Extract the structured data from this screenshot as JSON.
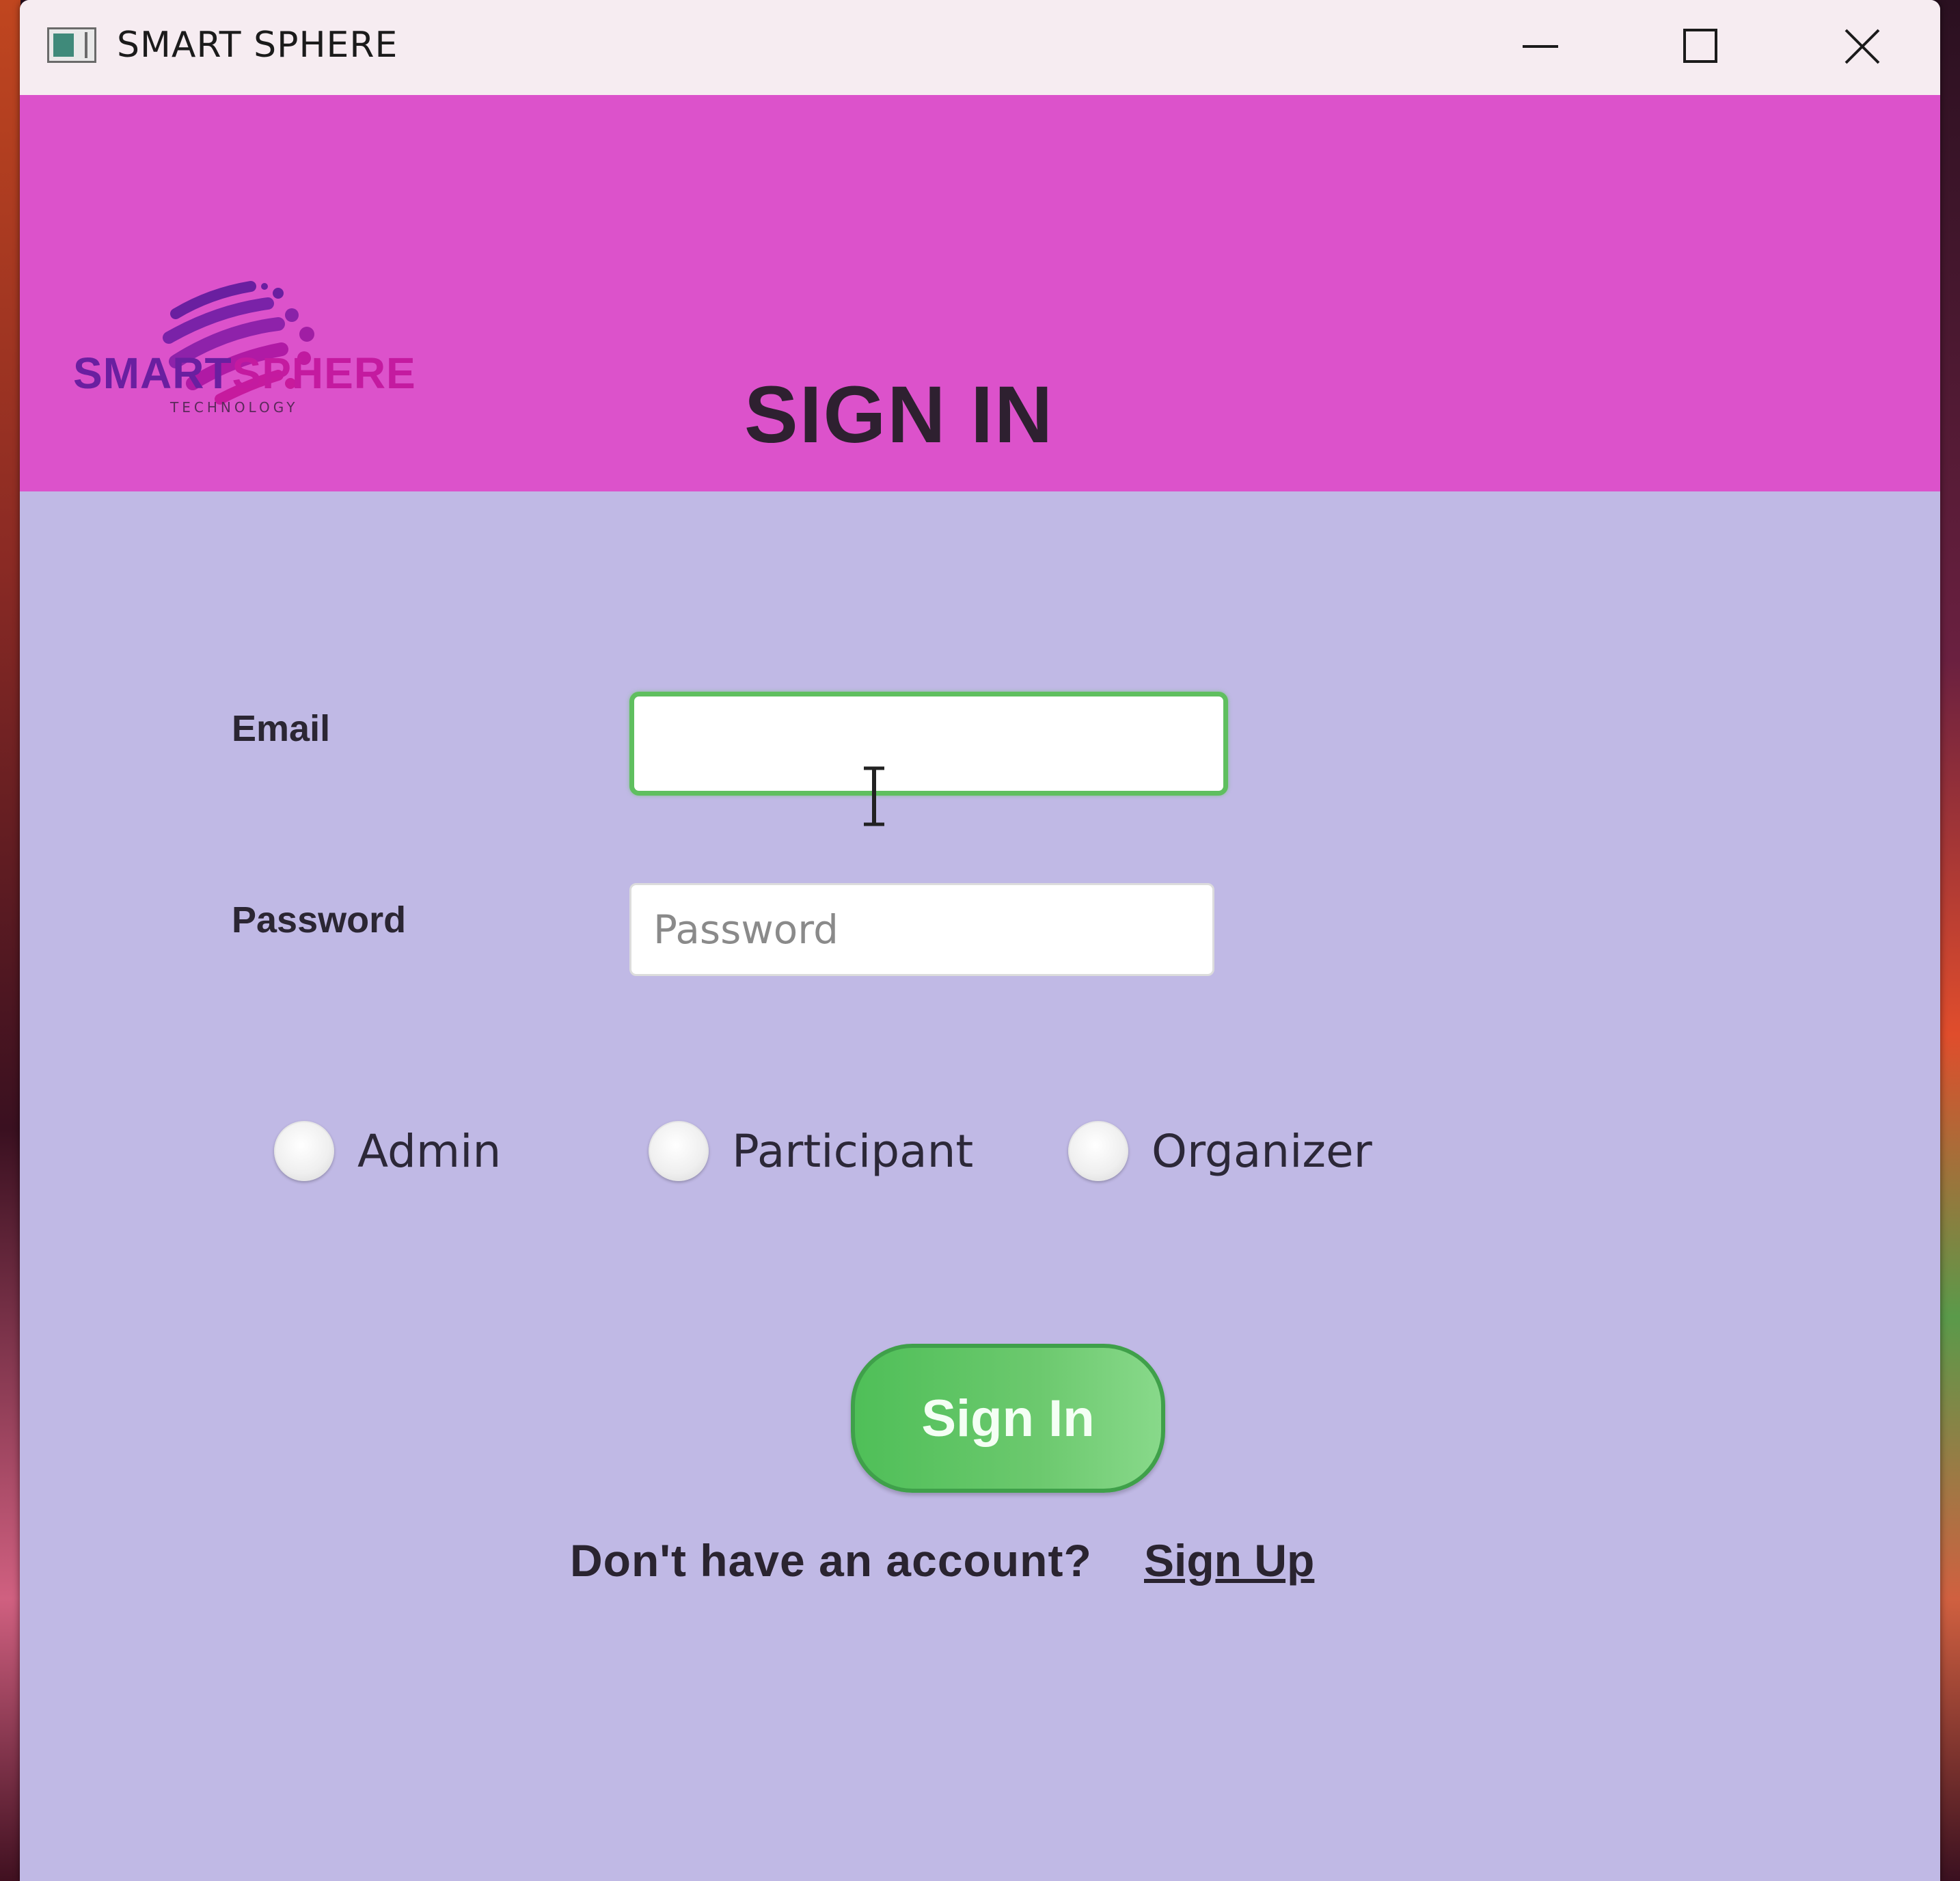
{
  "window": {
    "title": "SMART SPHERE"
  },
  "header": {
    "logo_word_part1": "SMART",
    "logo_word_part2": "SPHERE",
    "logo_sub": "TECHNOLOGY",
    "page_title": "SIGN IN"
  },
  "form": {
    "email_label": "Email",
    "email_value": "",
    "password_label": "Password",
    "password_placeholder": "Password",
    "password_value": ""
  },
  "roles": [
    {
      "label": "Admin",
      "selected": false
    },
    {
      "label": "Participant",
      "selected": false
    },
    {
      "label": "Organizer",
      "selected": false
    }
  ],
  "actions": {
    "sign_in_label": "Sign In",
    "no_account_text": "Don't have an account?",
    "sign_up_label": "Sign Up"
  },
  "colors": {
    "header_bg": "#dc52cb",
    "body_bg": "#c0b9e5",
    "accent_green": "#5fbf5f"
  },
  "icons": {
    "minimize": "minimize-icon",
    "maximize": "maximize-icon",
    "close": "close-icon",
    "app": "app-icon",
    "cursor": "text-cursor-icon"
  }
}
